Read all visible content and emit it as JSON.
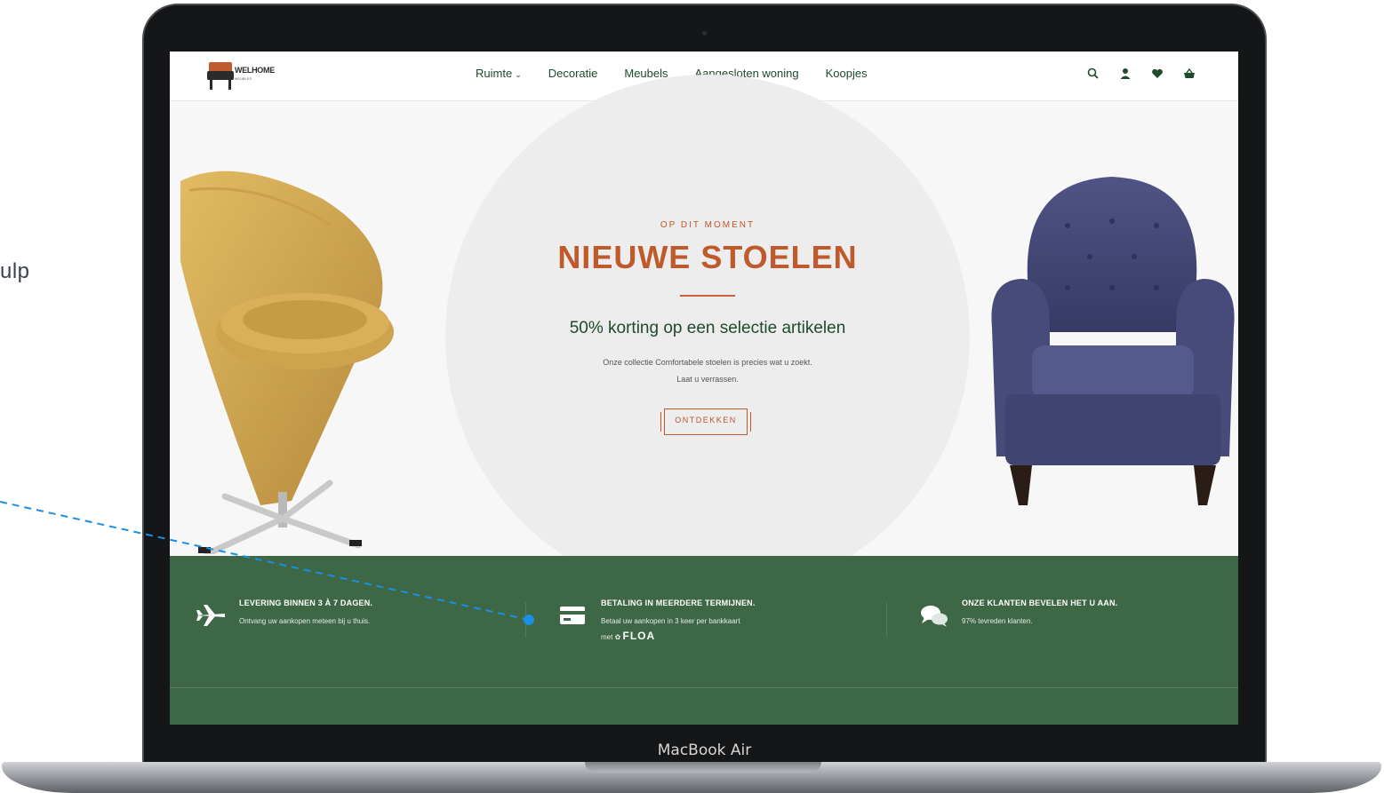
{
  "side_text": "ulp",
  "device": {
    "label": "MacBook Air"
  },
  "site": {
    "logo": {
      "name": "WELHOME",
      "tagline": "MEUBLES"
    },
    "nav": [
      {
        "label": "Ruimte",
        "has_dropdown": true
      },
      {
        "label": "Decoratie",
        "has_dropdown": false
      },
      {
        "label": "Meubels",
        "has_dropdown": false
      },
      {
        "label": "Aangesloten woning",
        "has_dropdown": false
      },
      {
        "label": "Koopjes",
        "has_dropdown": false
      }
    ],
    "header_icons": [
      "search-icon",
      "account-icon",
      "wishlist-heart-icon",
      "cart-basket-icon"
    ],
    "hero": {
      "eyebrow": "OP DIT MOMENT",
      "title": "NIEUWE STOELEN",
      "subtitle": "50% korting op een selectie artikelen",
      "description_line1": "Onze collectie Comfortabele stoelen is precies wat u zoekt.",
      "description_line2": "Laat u verrassen.",
      "cta": "ONTDEKKEN"
    },
    "features": [
      {
        "icon": "airplane-icon",
        "heading": "LEVERING BINNEN 3 À 7 DAGEN.",
        "text": "Ontvang uw aankopen meteen bij u thuis."
      },
      {
        "icon": "credit-card-icon",
        "heading": "BETALING IN MEERDERE TERMIJNEN.",
        "text": "Betaal uw aankopen in 3 keer per bankkaart",
        "text2": "met",
        "brand": "FLOA"
      },
      {
        "icon": "chat-bubbles-icon",
        "heading": "ONZE KLANTEN BEVELEN HET U AAN.",
        "text": "97% tevreden klanten."
      }
    ]
  },
  "colors": {
    "brand_green": "#3e6746",
    "accent_orange": "#bf5a2d",
    "nav_text": "#1f4a2b",
    "connector_blue": "#1a8fe3"
  }
}
